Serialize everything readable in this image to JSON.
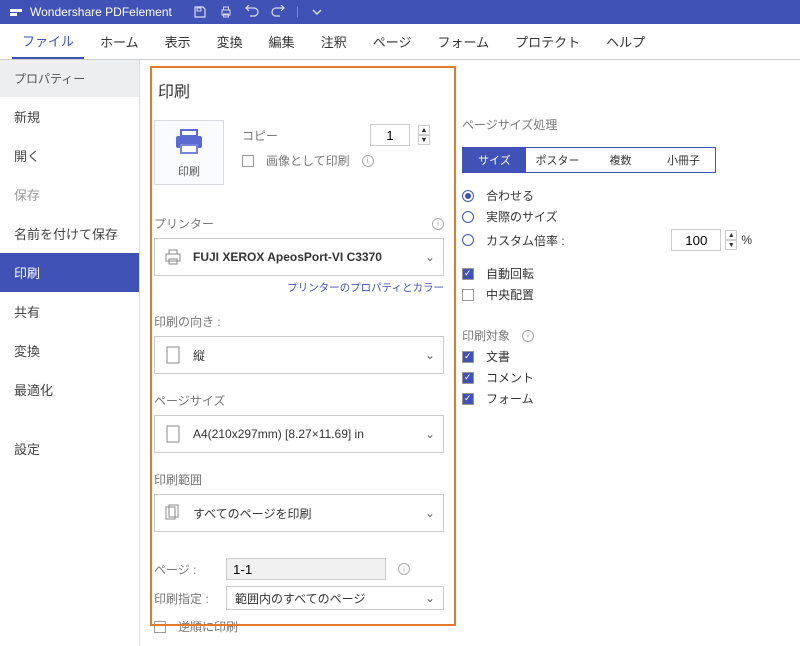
{
  "app": {
    "title": "Wondershare PDFelement"
  },
  "menu": {
    "items": [
      "ファイル",
      "ホーム",
      "表示",
      "変換",
      "編集",
      "注釈",
      "ページ",
      "フォーム",
      "プロテクト",
      "ヘルプ"
    ],
    "active": 0
  },
  "sidebar": {
    "header": "プロパティー",
    "items": [
      {
        "label": "新規",
        "dim": false
      },
      {
        "label": "開く",
        "dim": false
      },
      {
        "label": "保存",
        "dim": true
      },
      {
        "label": "名前を付けて保存",
        "dim": false
      },
      {
        "label": "印刷",
        "dim": false,
        "selected": true
      },
      {
        "label": "共有",
        "dim": false
      },
      {
        "label": "変換",
        "dim": false
      },
      {
        "label": "最適化",
        "dim": false
      },
      {
        "label": "設定",
        "dim": false
      }
    ]
  },
  "print": {
    "title": "印刷",
    "tile_label": "印刷",
    "copy_label": "コピー",
    "copy_value": "1",
    "print_as_image_label": "画像として印刷",
    "printer_label": "プリンター",
    "printer_selected": "FUJI XEROX ApeosPort-VI C3370",
    "printer_props_link": "プリンターのプロパティとカラー",
    "orientation_label": "印刷の向き :",
    "orientation_selected": "縦",
    "page_size_label": "ページサイズ",
    "page_size_selected": "A4(210x297mm) [8.27×11.69] in",
    "range_label": "印刷範囲",
    "range_selected": "すべてのページを印刷",
    "pages_label": "ページ :",
    "pages_value": "1-1",
    "subset_label": "印刷指定 :",
    "subset_selected": "範囲内のすべてのページ",
    "reverse_label": "逆順に印刷"
  },
  "right": {
    "page_handling_label": "ページサイズ処理",
    "tabs": [
      "サイズ",
      "ポスター",
      "複数",
      "小冊子"
    ],
    "tab_active": 0,
    "fit_label": "合わせる",
    "actual_label": "実際のサイズ",
    "custom_scale_label": "カスタム倍率 :",
    "custom_scale_value": "100",
    "custom_scale_unit": "%",
    "auto_rotate_label": "自動回転",
    "center_label": "中央配置",
    "print_target_label": "印刷対象",
    "doc_label": "文書",
    "comments_label": "コメント",
    "forms_label": "フォーム"
  }
}
